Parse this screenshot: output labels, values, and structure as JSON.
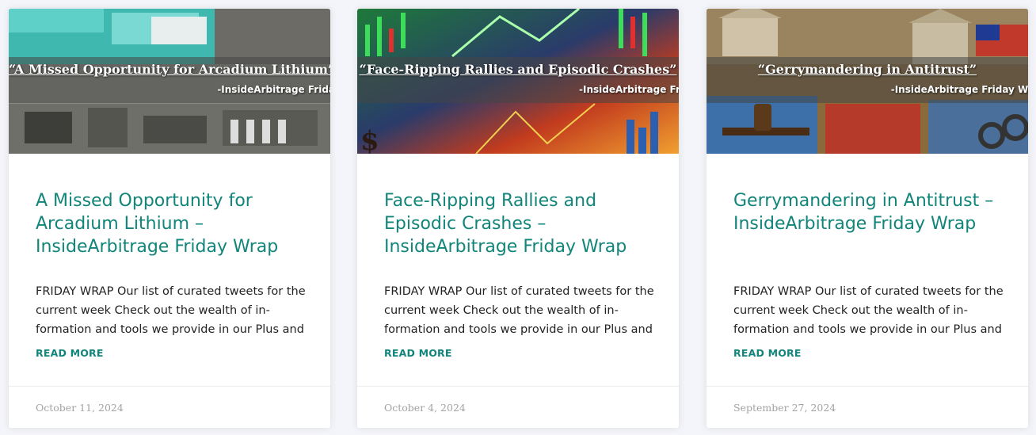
{
  "posts": [
    {
      "thumb_quote": "“A Missed Opportunity for Arcadium Lithium”",
      "thumb_source": "-InsideArbitrage Frida",
      "title": "A Missed Opportunity for Arcadium Lithium – InsideArbitrage Friday Wrap",
      "excerpt": "FRIDAY WRAP Our list of curated tweets for the current week Check out the wealth of in-formation and tools we provide in our Plus and",
      "read_more": "READ MORE",
      "date": "October 11, 2024"
    },
    {
      "thumb_quote": "“Face-Ripping Rallies and Episodic Crashes”",
      "thumb_source": "-InsideArbitrage Fri",
      "title": "Face-Ripping Rallies and Episodic Crashes – InsideArbitrage Friday Wrap",
      "excerpt": "FRIDAY WRAP Our list of curated tweets for the current week Check out the wealth of in-formation and tools we provide in our Plus and",
      "read_more": "READ MORE",
      "date": "October 4, 2024"
    },
    {
      "thumb_quote": "“Gerrymandering in Antitrust”",
      "thumb_source": "-InsideArbitrage Friday Wr",
      "title": "Gerrymandering in Antitrust – InsideArbitrage Friday Wrap",
      "excerpt": "FRIDAY WRAP Our list of curated tweets for the current week Check out the wealth of in-formation and tools we provide in our Plus and",
      "read_more": "READ MORE",
      "date": "September 27, 2024"
    }
  ],
  "colors": {
    "accent": "#12857a",
    "date": "#a3a3a3",
    "text": "#222222"
  }
}
